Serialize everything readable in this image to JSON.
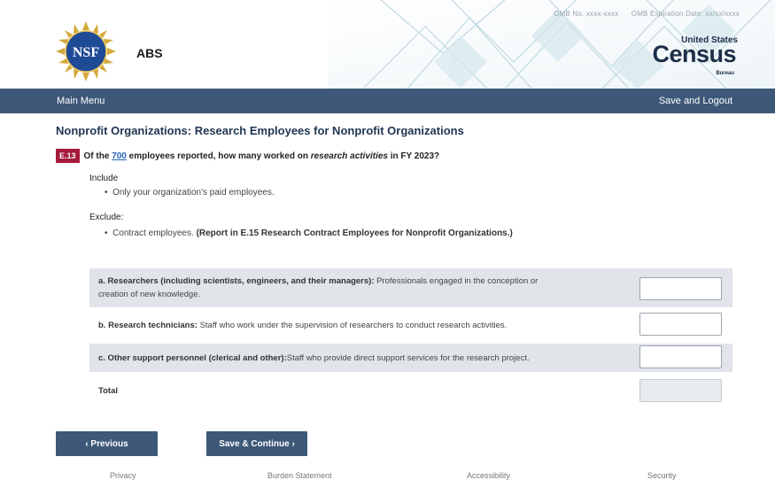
{
  "header": {
    "top_links": [
      "OMB No. xxxx-xxxx",
      "OMB Expiration Date: xx/xx/xxxx"
    ],
    "app_name": "ABS",
    "nsf_logo_text": "NSF",
    "census_logo": {
      "united_states": "United States",
      "census": "Census",
      "bureau": "Bureau"
    }
  },
  "nav": {
    "main_menu": "Main Menu",
    "save_logout": "Save and Logout"
  },
  "page": {
    "title": "Nonprofit Organizations: Research Employees for Nonprofit Organizations",
    "question": {
      "badge": "E.13",
      "text_before": "Of the ",
      "link_value": "700",
      "text_mid": " employees reported, how many worked on ",
      "emphasis": "research activities",
      "text_after": " in FY 2023?"
    },
    "include": {
      "label": "Include",
      "items": [
        "Only your organization's paid employees."
      ]
    },
    "exclude": {
      "label": "Exclude:",
      "item_text": "Contract employees. ",
      "item_bold": "(Report in E.15 Research Contract Employees for Nonprofit Organizations.)"
    }
  },
  "rows": [
    {
      "bold": "a. Researchers (including scientists, engineers, and their managers):",
      "text": " Professionals engaged in the conception or",
      "text2": "creation of new knowledge.",
      "value": ""
    },
    {
      "bold": "b. Research technicians:",
      "text": " Staff who work under the supervision of researchers to conduct research activities.",
      "value": ""
    },
    {
      "bold": "c. Other support personnel (clerical and other):",
      "text": "Staff who provide direct support services for the research project.",
      "value": ""
    },
    {
      "bold": "Total",
      "text": "",
      "value": ""
    }
  ],
  "buttons": {
    "previous": "‹  Previous",
    "next": "Save & Continue  ›"
  },
  "footer": {
    "links": [
      "Privacy",
      "Burden Statement",
      "Accessibility",
      "Security"
    ]
  },
  "colors": {
    "nav_bg": "#3d5878",
    "badge_bg": "#a61a3a",
    "row_shade": "#e1e5ea",
    "title": "#1f3552"
  }
}
